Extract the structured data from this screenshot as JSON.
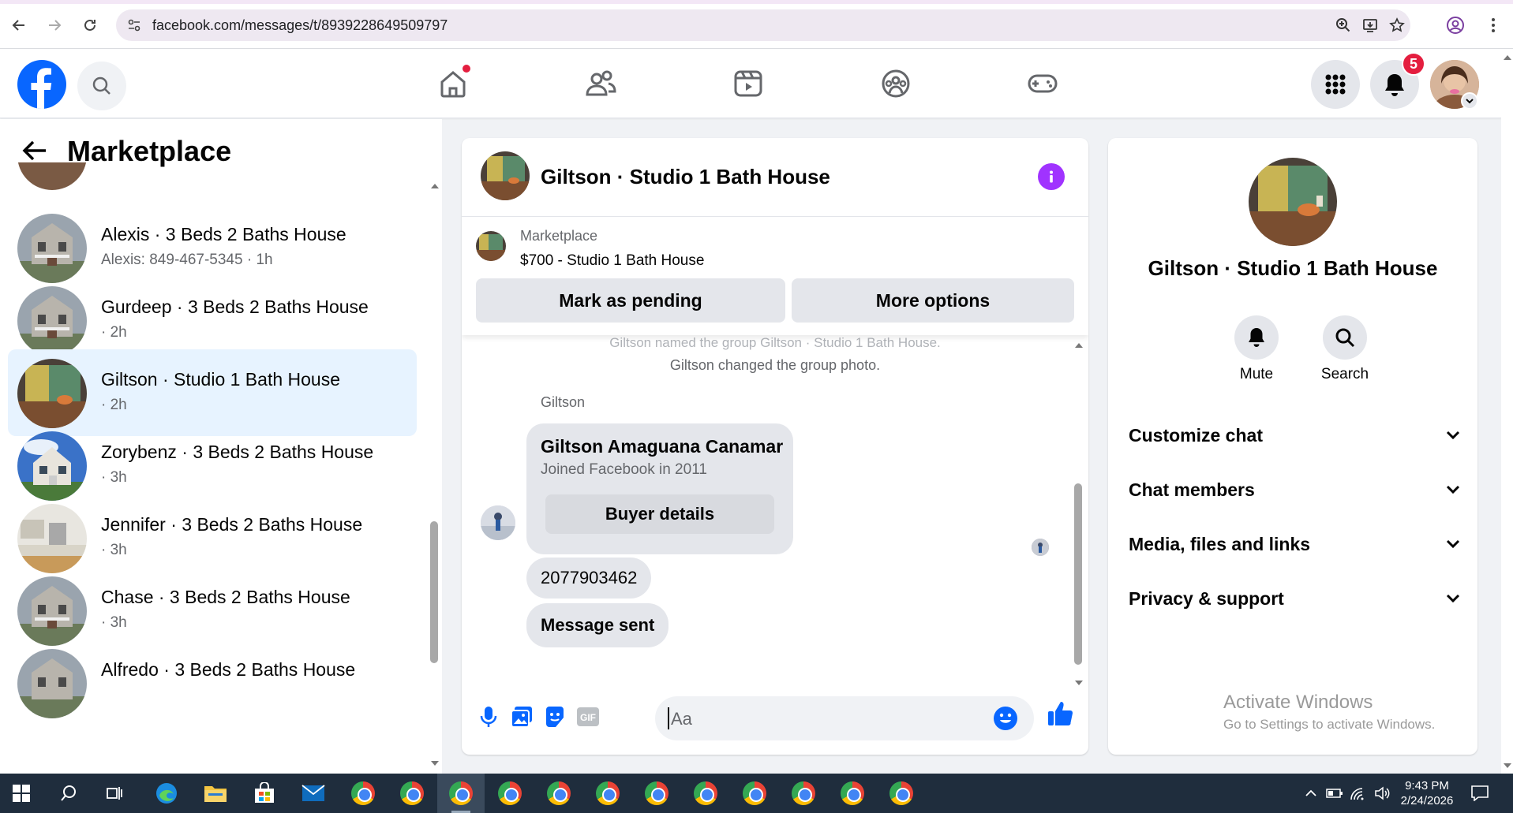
{
  "browser": {
    "url": "facebook.com/messages/t/8939228649509797"
  },
  "header": {
    "notification_count": "5"
  },
  "left": {
    "title": "Marketplace",
    "conversations": [
      {
        "name": "Alexis · 3 Beds 2 Baths House",
        "sub": "Alexis: 849-467-5345 · 1h"
      },
      {
        "name": "Gurdeep · 3 Beds 2 Baths House",
        "sub": "· 2h"
      },
      {
        "name": "Giltson · Studio 1 Bath House",
        "sub": "· 2h"
      },
      {
        "name": "Zorybenz · 3 Beds 2 Baths House",
        "sub": "· 3h"
      },
      {
        "name": "Jennifer · 3 Beds 2 Baths House",
        "sub": "· 3h"
      },
      {
        "name": "Chase · 3 Beds 2 Baths House",
        "sub": "· 3h"
      },
      {
        "name": "Alfredo · 3 Beds 2 Baths House",
        "sub": ""
      }
    ]
  },
  "chat": {
    "title": "Giltson · Studio 1 Bath House",
    "marketplace_label": "Marketplace",
    "listing": "$700 - Studio 1 Bath House",
    "mark_pending": "Mark as pending",
    "more_options": "More options",
    "system_faded": "Giltson named the group Giltson · Studio 1 Bath House.",
    "system_photo": "Giltson changed the group photo.",
    "sender": "Giltson",
    "card_name": "Giltson Amaguana Canamar",
    "card_joined": "Joined Facebook in 2011",
    "card_button": "Buyer details",
    "phone_msg": "2077903462",
    "sent_msg": "Message sent",
    "composer_placeholder": "Aa"
  },
  "info": {
    "name": "Giltson · Studio 1 Bath House",
    "mute": "Mute",
    "search": "Search",
    "rows": [
      "Customize chat",
      "Chat members",
      "Media, files and links",
      "Privacy & support"
    ],
    "activate_title": "Activate Windows",
    "activate_sub": "Go to Settings to activate Windows."
  },
  "taskbar": {
    "time": "9:43 PM",
    "date": "2/24/2026"
  }
}
